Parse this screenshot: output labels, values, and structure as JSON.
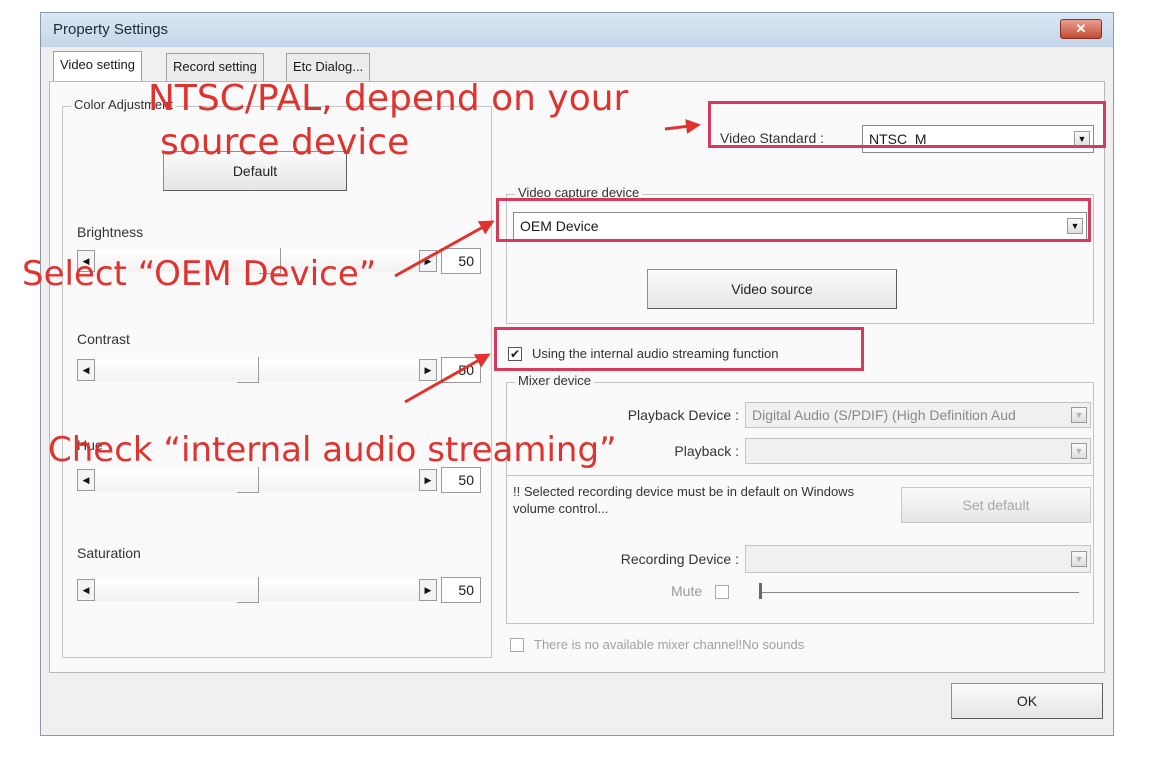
{
  "dialog": {
    "title": "Property Settings",
    "close_label": "✕"
  },
  "tabs": [
    {
      "label": "Video setting",
      "active": true
    },
    {
      "label": "Record setting",
      "active": false
    },
    {
      "label": "Etc Dialog...",
      "active": false
    }
  ],
  "color_adjustment": {
    "legend": "Color Adjustment",
    "default_button": "Default",
    "sliders": [
      {
        "label": "Brightness",
        "value": "50"
      },
      {
        "label": "Contrast",
        "value": "50"
      },
      {
        "label": "Hue",
        "value": "50"
      },
      {
        "label": "Saturation",
        "value": "50"
      }
    ]
  },
  "video_standard": {
    "label": "Video Standard :",
    "value": "NTSC_M"
  },
  "capture_device": {
    "legend": "Video capture device",
    "value": "OEM Device",
    "video_source_button": "Video source"
  },
  "audio_streaming": {
    "label": "Using the internal audio streaming function",
    "checked": true
  },
  "mixer": {
    "legend": "Mixer device",
    "playback_label": "Playback Device :",
    "playback_value": "Digital Audio (S/PDIF) (High Definition Aud",
    "playback2_label": "Playback :",
    "playback2_value": "",
    "notice": "!! Selected recording device must be in default on Windows volume control...",
    "set_default_button": "Set default",
    "recording_label": "Recording Device :",
    "recording_value": "",
    "mute_label": "Mute"
  },
  "no_mixer": {
    "label": "There is no available mixer channel!No sounds",
    "checked": false
  },
  "ok_button": "OK",
  "annotations": {
    "standard_line1": "NTSC/PAL, depend on your",
    "standard_line2": "source device",
    "select_oem": "Select “OEM Device”",
    "check_audio": "Check “internal audio streaming”"
  },
  "colors": {
    "annotation": "#e0322f",
    "highlight_box": "#d83a5c"
  },
  "icons": {
    "scroll_left": "◀",
    "scroll_right": "▶",
    "dropdown": "▼",
    "check": "✔"
  }
}
